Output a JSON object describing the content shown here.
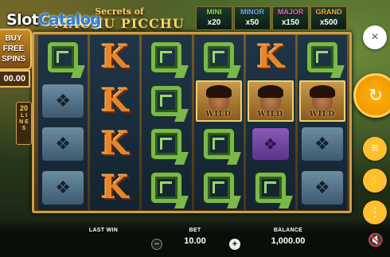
{
  "watermark": {
    "part1": "Slot",
    "part2": "Catalog"
  },
  "title": {
    "line1": "Secrets of",
    "line2": "MACHU PICCHU"
  },
  "jackpots": [
    {
      "name": "MINI",
      "value": "x20",
      "color": "#9bd64a"
    },
    {
      "name": "MINOR",
      "value": "x50",
      "color": "#6ab0e8"
    },
    {
      "name": "MAJOR",
      "value": "x150",
      "color": "#e86ab8"
    },
    {
      "name": "GRAND",
      "value": "x500",
      "color": "#f3b23a"
    }
  ],
  "buy_feature": {
    "line1": "BUY",
    "line2": "FREE",
    "line3": "SPINS",
    "price": "00.00"
  },
  "lines_badge": {
    "number": "20",
    "label1": "L I",
    "label2": "N E",
    "label3": "S"
  },
  "reels": [
    [
      "Q",
      "eagle",
      "eagle",
      "eagle"
    ],
    [
      "K",
      "K",
      "K",
      "K"
    ],
    [
      "Q",
      "Q",
      "Q",
      "Q"
    ],
    [
      "Q",
      "wild",
      "Q",
      "Q"
    ],
    [
      "K",
      "wild",
      "gold",
      "Q"
    ],
    [
      "Q",
      "wild",
      "eagle",
      "eagle"
    ]
  ],
  "symbols": {
    "K": "K",
    "Q": "",
    "wild_label": "WILD",
    "eagle_icon": "eagle-glyph",
    "gold_icon": "bird-glyph"
  },
  "bottom_bar": {
    "last_win_label": "LAST WIN",
    "last_win_value": "",
    "bet_label": "BET",
    "bet_value": "10.00",
    "balance_label": "BALANCE",
    "balance_value": "1,000.00",
    "minus": "−",
    "plus": "+"
  },
  "side_menu": {
    "close_icon": "×",
    "spin_icon": "↻",
    "coins_icon": "≡",
    "lightning_icon": "⚡",
    "menu_icon": "⋮"
  },
  "sound_icon": "🔇"
}
